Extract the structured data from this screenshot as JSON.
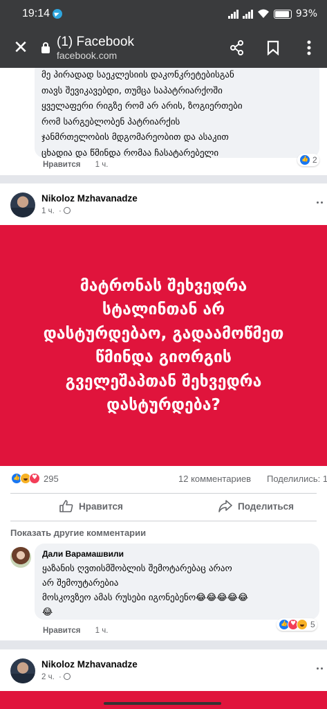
{
  "status_bar": {
    "time": "19:14",
    "battery": "93"
  },
  "browser": {
    "title": "(1) Facebook",
    "host": "facebook.com"
  },
  "comment_top": {
    "text": "მე პირადად საეკლესიის დაკონკრეტებისგან\nთავს შევიკავებდი, თუმცა საპატრიარქოში\nყველაფერი რიგზე რომ არ არის, ზოგიერთები\nრომ სარგებლობენ პატრიარქის\nჯანმრთელობის მდგომარეობით და ასაკით\nცხადია და წმინდა რომაა ჩასატარებელი",
    "like_label": "Нравится",
    "time": "1 ч.",
    "reactions_count": "2"
  },
  "post1": {
    "author": "Nikoloz Mzhavanadze",
    "time": "1 ч.",
    "image_text": "მატრონას შეხვედრა\nსტალინთან არ\nდასტურდებაო, გადაამოწმეთ\nწმინდა გიორგის\nგველეშაპთან შეხვედრა\nდასტურდება?",
    "reactions_count": "295",
    "comments_count": "12 комментариев",
    "shares_label": "Поделились: 1",
    "like_button": "Нравится",
    "share_button": "Поделиться",
    "more_comments": "Показать другие комментарии",
    "comment": {
      "author": "Дали Варамашвили",
      "text": "ყაზანის ღვთისმშობლის შემოტარებაც არაო\nარ შემოუტარებია\nმოსკოვზეო ამას რუსები იგონებენო😂😂😂😂😂\n😂",
      "like_label": "Нравится",
      "time": "1 ч.",
      "reactions_count": "5"
    }
  },
  "post2": {
    "author": "Nikoloz Mzhavanadze",
    "time": "2 ч."
  },
  "colors": {
    "accent": "#1877f2",
    "red_bg": "#e0143c",
    "topbar": "#3a3b3d"
  }
}
